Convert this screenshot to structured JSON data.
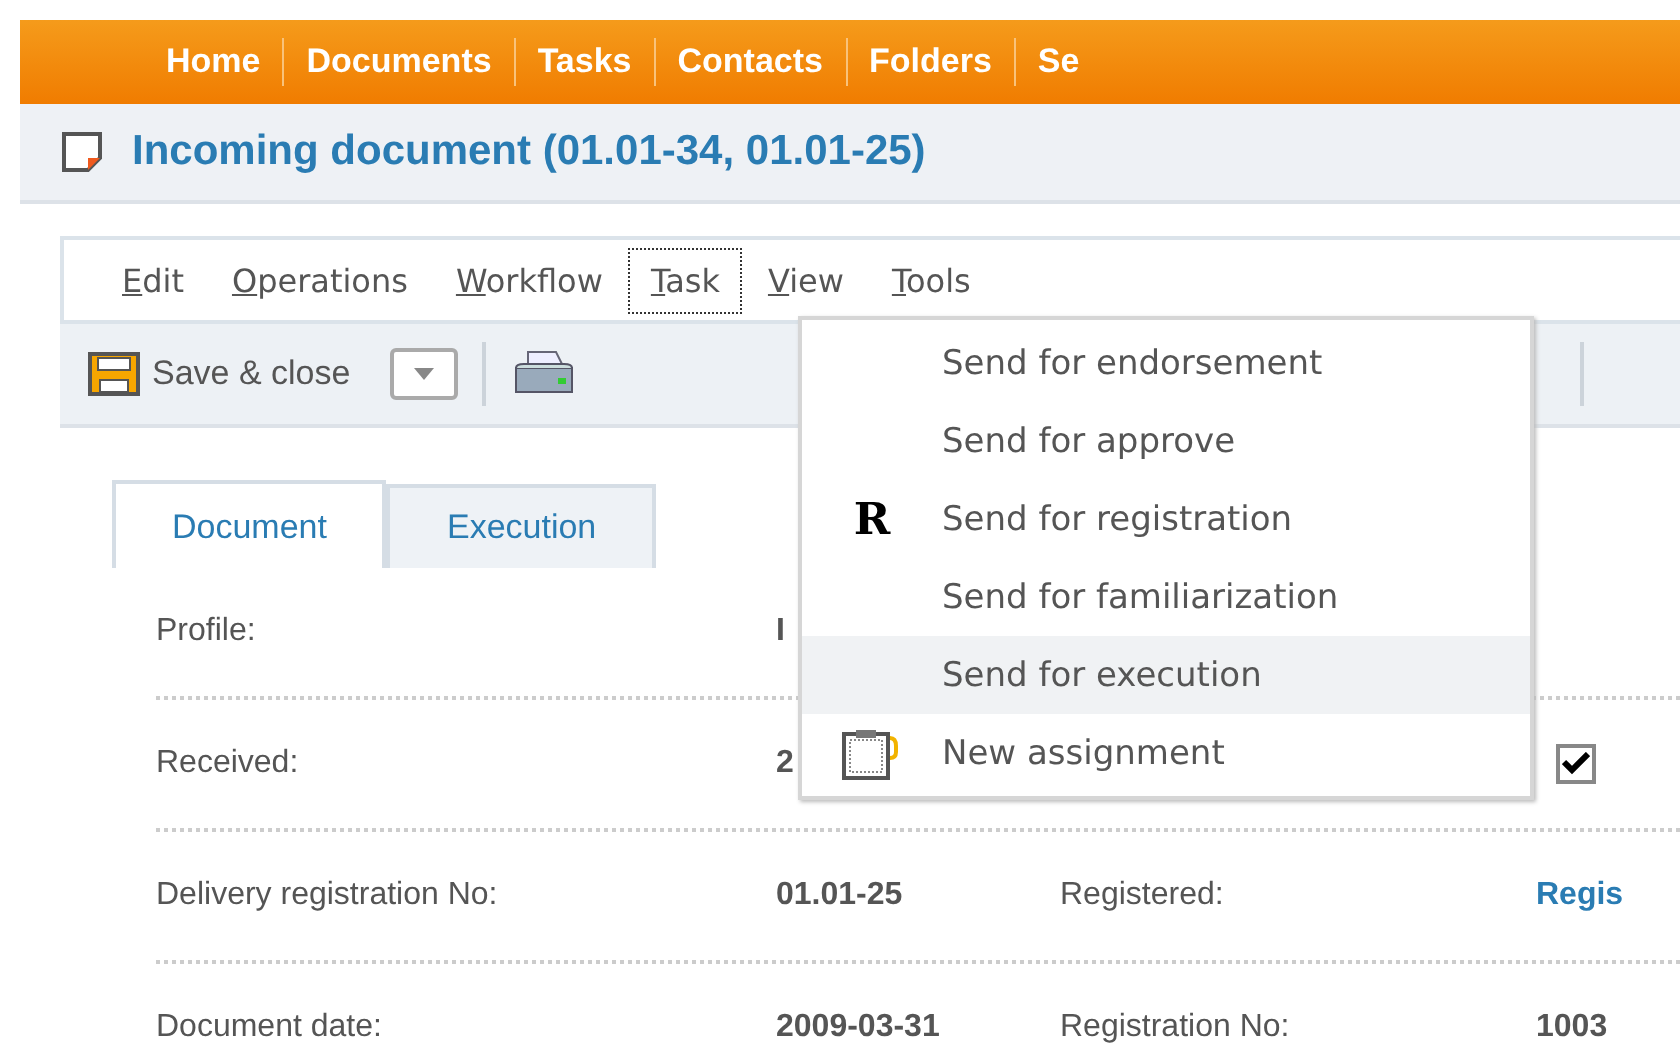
{
  "nav": [
    {
      "label": "Home"
    },
    {
      "label": "Documents"
    },
    {
      "label": "Tasks"
    },
    {
      "label": "Contacts"
    },
    {
      "label": "Folders"
    },
    {
      "label": "Se"
    }
  ],
  "title": "Incoming document (01.01-34, 01.01-25)",
  "menu": [
    {
      "label": "Edit",
      "selected": false
    },
    {
      "label": "Operations",
      "selected": false
    },
    {
      "label": "Workflow",
      "selected": false
    },
    {
      "label": "Task",
      "selected": true
    },
    {
      "label": "View",
      "selected": false
    },
    {
      "label": "Tools",
      "selected": false
    }
  ],
  "toolbar": {
    "save_label": "Save & close"
  },
  "dropdown": [
    {
      "label": "Send for endorsement",
      "kind": "plain",
      "selected": false
    },
    {
      "label": "Send for approve",
      "kind": "plain",
      "selected": false
    },
    {
      "label": "Send for registration",
      "kind": "letter",
      "icon_text": "R",
      "selected": false
    },
    {
      "label": "Send for familiarization",
      "kind": "plain",
      "selected": false
    },
    {
      "label": "Send for execution",
      "kind": "plain",
      "selected": true
    },
    {
      "label": "New assignment",
      "kind": "clipboard",
      "selected": false
    }
  ],
  "tabs": [
    {
      "label": "Document",
      "selected": true
    },
    {
      "label": "Execution",
      "selected": false
    }
  ],
  "fields": [
    {
      "label": "Profile:",
      "value": "I"
    },
    {
      "label": "Received:",
      "value": "2",
      "checkbox": {
        "checked": true
      }
    },
    {
      "label": "Delivery registration No:",
      "value": "01.01-25",
      "label2": "Registered:",
      "value2": "Regis",
      "value2_link": true
    },
    {
      "label": "Document date:",
      "value": "2009-03-31",
      "label2": "Registration No:",
      "value2": "1003",
      "value2_link": false
    }
  ]
}
